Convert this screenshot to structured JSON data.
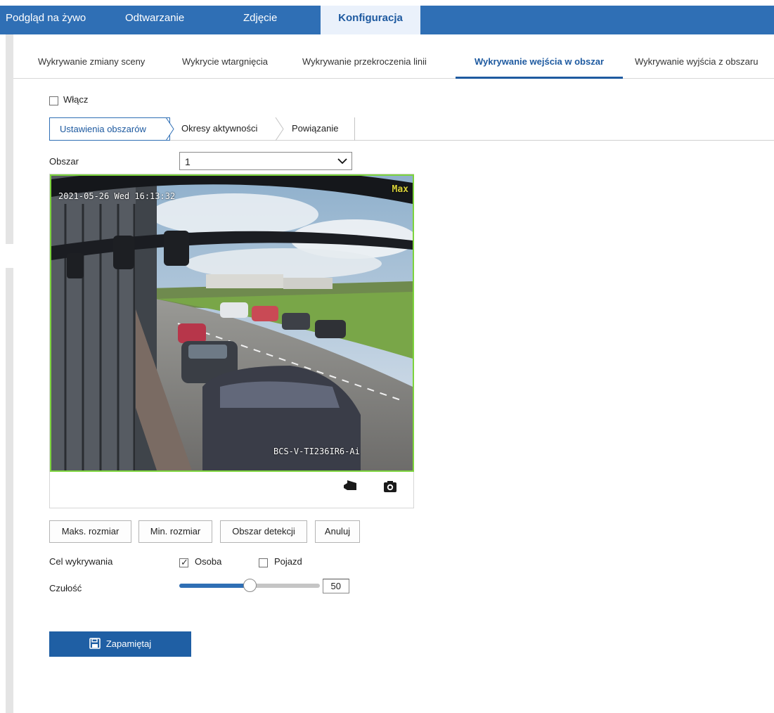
{
  "topnav": {
    "items": [
      {
        "label": "Podgląd na żywo"
      },
      {
        "label": "Odtwarzanie"
      },
      {
        "label": "Zdjęcie"
      },
      {
        "label": "Konfiguracja"
      }
    ],
    "active_index": 3
  },
  "subtabs": [
    {
      "label": "Wykrywanie zmiany sceny"
    },
    {
      "label": "Wykrycie wtargnięcia"
    },
    {
      "label": "Wykrywanie przekroczenia linii"
    },
    {
      "label": "Wykrywanie wejścia w obszar"
    },
    {
      "label": "Wykrywanie wyjścia z obszaru"
    }
  ],
  "enable": {
    "label": "Włącz",
    "checked": false
  },
  "steps": [
    {
      "label": "Ustawienia obszarów"
    },
    {
      "label": "Okresy aktywności"
    },
    {
      "label": "Powiązanie"
    }
  ],
  "area": {
    "label": "Obszar",
    "value": "1"
  },
  "video": {
    "timestamp": "2021-05-26 Wed 16:13:32",
    "max_label": "Max",
    "camera_name": "BCS-V-TI236IR6-Ai"
  },
  "video_tools": {
    "record_icon": "video-record-icon",
    "snapshot_icon": "camera-icon"
  },
  "buttons": {
    "max_size": "Maks. rozmiar",
    "min_size": "Min. rozmiar",
    "detect_area": "Obszar detekcji",
    "cancel": "Anuluj"
  },
  "target": {
    "label": "Cel wykrywania",
    "person": {
      "label": "Osoba",
      "checked": true
    },
    "vehicle": {
      "label": "Pojazd",
      "checked": false
    }
  },
  "sensitivity": {
    "label": "Czułość",
    "value": "50",
    "fraction": 0.5
  },
  "save": {
    "label": "Zapamiętaj"
  },
  "colors": {
    "accent": "#2f6fb5",
    "region_border": "#7cd43c",
    "save_bg": "#1f5fa4"
  }
}
